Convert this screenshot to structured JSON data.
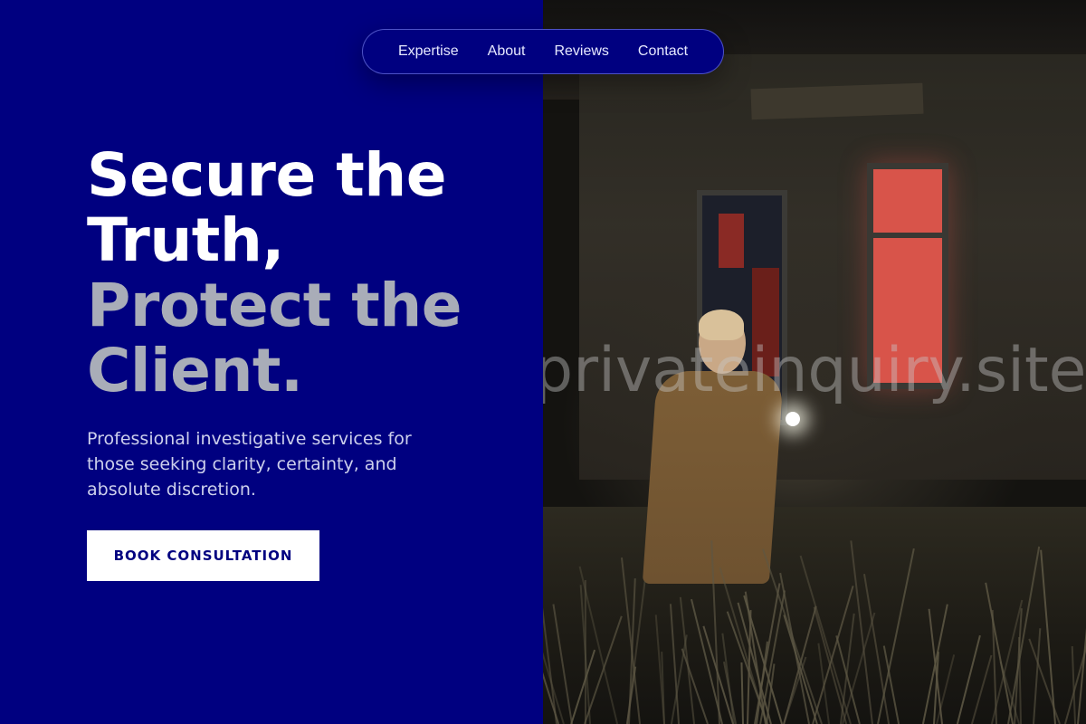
{
  "nav": {
    "items": [
      {
        "label": "Expertise"
      },
      {
        "label": "About"
      },
      {
        "label": "Reviews"
      },
      {
        "label": "Contact"
      }
    ]
  },
  "hero": {
    "title_line1": "Secure the",
    "title_line2": "Truth,",
    "title_line3": "Protect the",
    "title_line4": "Client.",
    "description": "Professional investigative services for those seeking clarity, certainty, and absolute discretion.",
    "cta_label": "BOOK CONSULTATION"
  },
  "watermark": "privateinquiry.site",
  "colors": {
    "brand_navy": "#000080",
    "title_white": "#ffffff",
    "title_grey": "#a9adb8",
    "cta_bg": "#ffffff",
    "cta_text": "#000080"
  }
}
